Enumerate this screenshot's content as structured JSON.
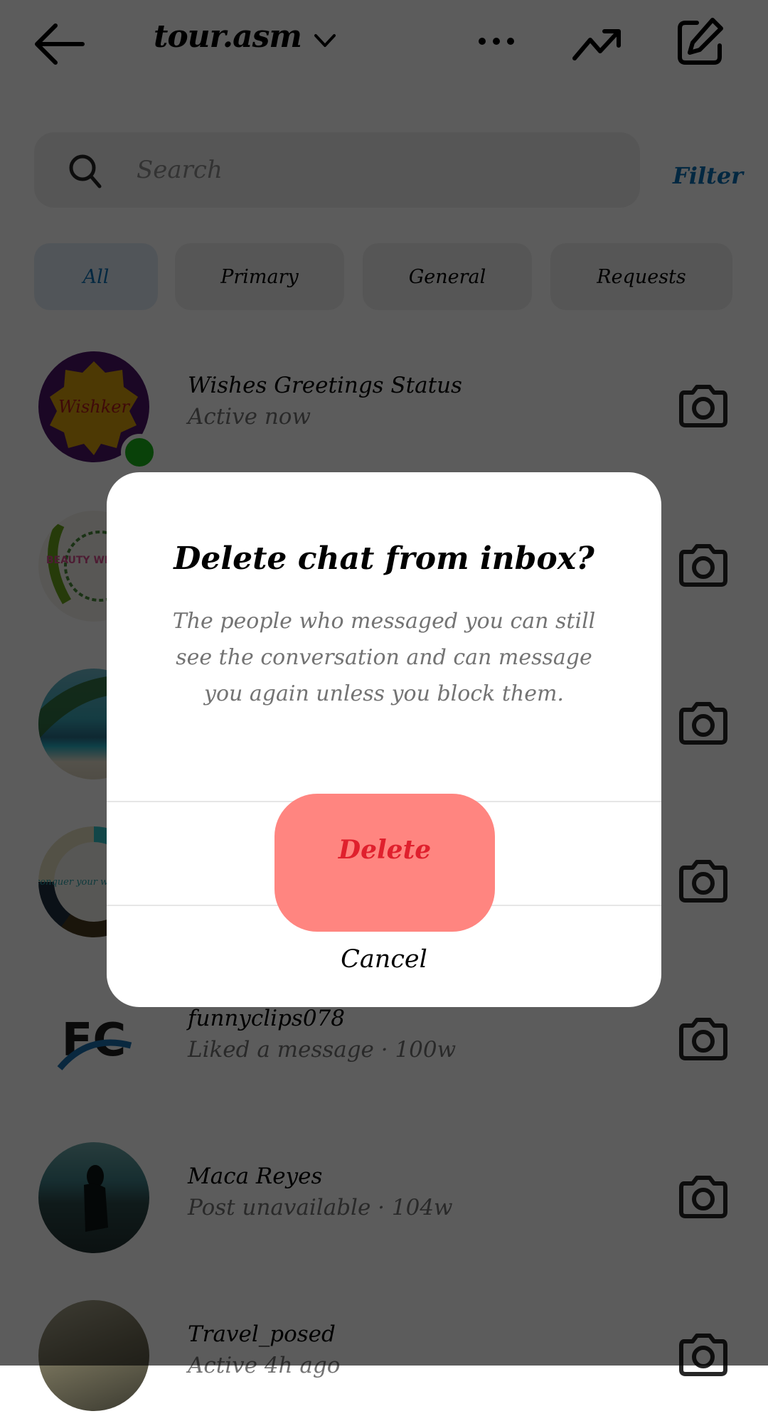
{
  "header": {
    "account_name": "tour.asm",
    "icons": {
      "back": "arrow-left-icon",
      "account_switch": "chevron-down-icon",
      "more": "more-horizontal-icon",
      "trending": "trending-up-icon",
      "compose": "new-message-icon"
    }
  },
  "search": {
    "placeholder": "Search",
    "value": "",
    "filter_label": "Filter"
  },
  "tabs": [
    {
      "label": "All",
      "active": true
    },
    {
      "label": "Primary",
      "active": false
    },
    {
      "label": "General",
      "active": false
    },
    {
      "label": "Requests",
      "active": false
    }
  ],
  "chats": [
    {
      "name": "Wishes Greetings Status",
      "subtitle": "Active now",
      "online": true,
      "avatar_text": "Wishker"
    },
    {
      "name": "",
      "subtitle": "",
      "avatar_text": "BEAUTY WELLNESS"
    },
    {
      "name": "",
      "subtitle": "",
      "avatar_text": ""
    },
    {
      "name": "",
      "subtitle": "",
      "avatar_text": "conquer your wanderlust"
    },
    {
      "name": "funnyclips078",
      "subtitle": "Liked a message · 100w",
      "avatar_text": "FC"
    },
    {
      "name": "Maca Reyes",
      "subtitle": "Post unavailable · 104w",
      "avatar_text": ""
    },
    {
      "name": "Travel_posed",
      "subtitle": "Active 4h ago",
      "avatar_text": ""
    }
  ],
  "dialog": {
    "title": "Delete chat from inbox?",
    "body": "The people who messaged you can still see the conversation and can message you again unless you block them.",
    "delete_label": "Delete",
    "cancel_label": "Cancel"
  },
  "colors": {
    "accent_blue": "#0a6fb3",
    "delete_red": "#e0202d",
    "delete_highlight": "#ff8580",
    "online_green": "#1bb51b"
  }
}
